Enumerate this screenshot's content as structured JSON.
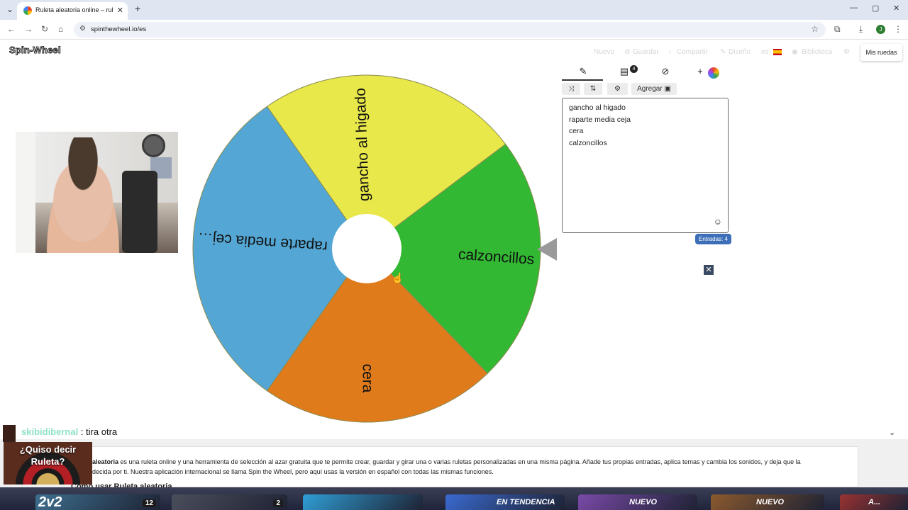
{
  "browser": {
    "tab_title": "Ruleta aleatoria online – ruleta",
    "tab_close": "✕",
    "new_tab": "+",
    "tab_menu": "⌄",
    "url": "spinthewheel.io/es",
    "profile_initial": "J",
    "window_controls": [
      "—",
      "▢",
      "✕"
    ]
  },
  "site": {
    "logo": "Spin-Wheel",
    "nav": {
      "new": "Nuevo",
      "save": "Guardar",
      "share": "Compartir",
      "design": "Diseño",
      "lang": "es",
      "library": "Biblioteca"
    },
    "my_wheels": "Mis ruedas"
  },
  "wheel": {
    "segments": [
      {
        "label": "gancho al higado",
        "color": "#e8e84a"
      },
      {
        "label": "calzoncillos",
        "color": "#33b833"
      },
      {
        "label": "cera",
        "color": "#e07b1c"
      },
      {
        "label": "raparte media cej…",
        "color": "#54a7d4"
      }
    ],
    "border_color": "#8a8a50"
  },
  "panel": {
    "tabs": {
      "edit_icon": "pencil-icon",
      "clipboard_badge": "4"
    },
    "add_button": "Agregar",
    "entries": [
      "gancho al higado",
      "raparte media ceja",
      "cera",
      "calzoncillos"
    ],
    "entries_badge": "Entradas: 4",
    "emoji_icon": "☺",
    "close_x": "✕"
  },
  "chat": {
    "user": "skibidibernal",
    "message": ": tira otra"
  },
  "overlay": {
    "text": "¿Quiso decir Ruleta?"
  },
  "description": {
    "bold": "aleatoria",
    "text": " es una ruleta online y una herramienta de selección al azar gratuita que te permite crear, guardar y girar una o varias ruletas personalizadas en una misma página. Añade tus propias entradas, aplica temas y cambia los sonidos, y deja que la",
    "text2": "decida por ti. Nuestra aplicación internacional se llama Spin the Wheel, pero aquí usas la versión en español con todas las mismas funciones.",
    "heading": "Cómo usar Ruleta aleatoria"
  },
  "taskbar": {
    "tiles": [
      {
        "label": "2v2",
        "badge": "12",
        "color": "#3d6f8f"
      },
      {
        "label": "",
        "badge": "2",
        "color": "#4b4f5c"
      },
      {
        "label": "",
        "badge": "",
        "color": "#2f9fd6"
      },
      {
        "label": "EN TENDENCIA",
        "badge": "",
        "color": "#3a6ad0"
      },
      {
        "label": "NUEVO",
        "badge": "",
        "color": "#7a4aa8"
      },
      {
        "label": "NUEVO",
        "badge": "",
        "color": "#8c5a2e"
      },
      {
        "label": "A...",
        "badge": "",
        "color": "#9a3232"
      }
    ]
  }
}
